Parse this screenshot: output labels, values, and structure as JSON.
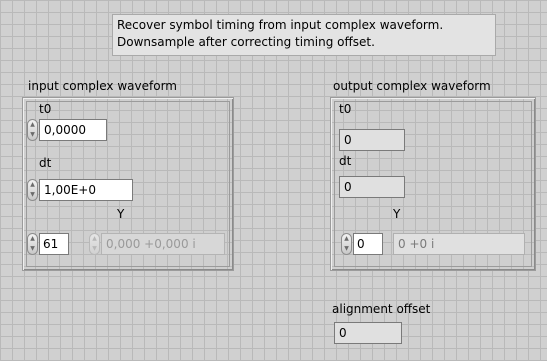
{
  "description": {
    "line1": "Recover symbol timing from input complex waveform.",
    "line2": "Downsample after correcting timing offset."
  },
  "input_cluster": {
    "title": "input complex waveform",
    "t0_label": "t0",
    "t0_value": "0,0000",
    "dt_label": "dt",
    "dt_value": "1,00E+0",
    "y_label": "Y",
    "y_index": "61",
    "y_element": "0,000 +0,000 i"
  },
  "output_cluster": {
    "title": "output complex waveform",
    "t0_label": "t0",
    "t0_value": "0",
    "dt_label": "dt",
    "dt_value": "0",
    "y_label": "Y",
    "y_index": "0",
    "y_element": "0 +0 i"
  },
  "alignment": {
    "label": "alignment offset",
    "value": "0"
  },
  "spinner_icons": {
    "up": "triangle-up",
    "down": "triangle-down"
  }
}
